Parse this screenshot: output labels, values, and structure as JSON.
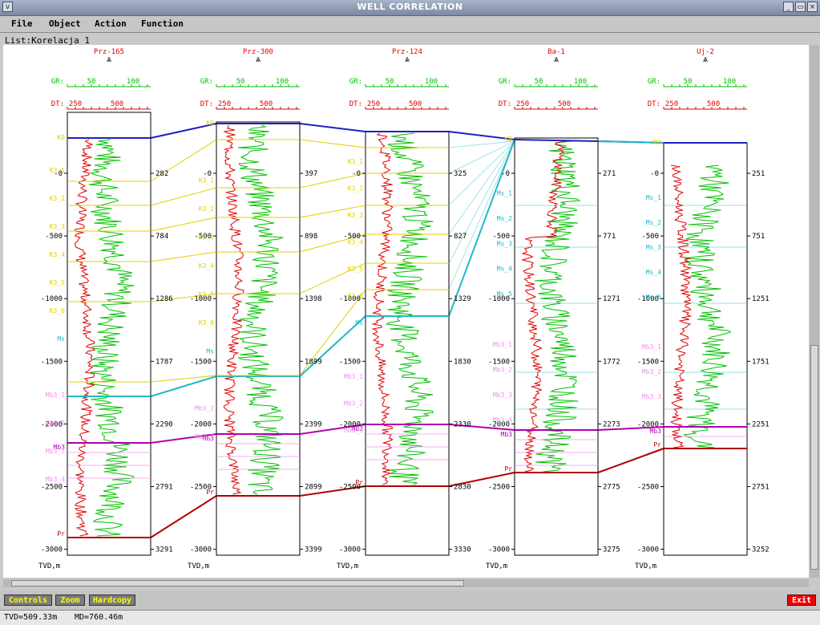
{
  "window": {
    "title": "WELL CORRELATION"
  },
  "menu": [
    "File",
    "Object",
    "Action",
    "Function"
  ],
  "list_label": "List:Korelacja_1",
  "scales": {
    "gr_label": "GR:",
    "gr_ticks": [
      "50",
      "100"
    ],
    "dt_label": "DT:",
    "dt_ticks": [
      "250",
      "500"
    ],
    "axis_unit": "TVD,m"
  },
  "depth_ticks": [
    "-0",
    "-500",
    "-1000",
    "-1500",
    "-2000",
    "-2500",
    "-3000"
  ],
  "colors": {
    "gr_curve": "#00c000",
    "dt_curve": "#e00000",
    "top_K": "#2020c0",
    "cretaceous": "#e0d000",
    "ms": "#20b8c8",
    "mb3": "#b000b0",
    "mb3_sub": "#f090f0",
    "pr": "#b00000"
  },
  "wells": [
    {
      "name": "Prz-165",
      "md_ticks": [
        "282",
        "784",
        "1286",
        "1787",
        "2290",
        "2791",
        "3291"
      ],
      "left_markers": [
        "K0",
        "K3_1",
        "K3_2",
        "K3_3",
        "K3_4",
        "K3_5",
        "K3_6",
        "Ms",
        "Mb3",
        "Mb3_1",
        "Mb3_2",
        "Mb3_3",
        "Mb3_4",
        "Pr"
      ]
    },
    {
      "name": "Prz-300",
      "md_ticks": [
        "397",
        "898",
        "1398",
        "1899",
        "2399",
        "2899",
        "3399"
      ],
      "left_markers": [
        "K0",
        "K3_1",
        "K3_2",
        "K3_3",
        "K3_4",
        "K3_5",
        "K3_6",
        "Ms",
        "Mb3",
        "Mb3_2",
        "Mb3_3",
        "Pr"
      ]
    },
    {
      "name": "Prz-124",
      "md_ticks": [
        "325",
        "827",
        "1329",
        "1830",
        "2330",
        "2830",
        "3330"
      ],
      "left_markers": [
        "K3_1",
        "K3_2",
        "K3_3",
        "K3_4",
        "K3_5",
        "K3_6",
        "Ms",
        "Mb3",
        "Mb3_1",
        "Mb3_2",
        "Mb3_3",
        "Pr"
      ]
    },
    {
      "name": "Ba-1",
      "md_ticks": [
        "271",
        "771",
        "1271",
        "1772",
        "2273",
        "2775",
        "3275"
      ],
      "left_markers": [
        "K0",
        "Ms_1",
        "Ms_2",
        "Ms_3",
        "Ms_4",
        "Ms_5",
        "Mb3",
        "Mb3_1",
        "Mb3_2",
        "Mb3_3",
        "Mb3_4",
        "Pr"
      ]
    },
    {
      "name": "Uj-2",
      "md_ticks": [
        "251",
        "751",
        "1251",
        "1751",
        "2251",
        "2751",
        "3252"
      ],
      "left_markers": [
        "K0",
        "Ms_1",
        "Ms_2",
        "Ms_3",
        "Ms_4",
        "Ms_5",
        "Mb3",
        "Mb3_1",
        "Mb3_2",
        "Mb3_3",
        "Pr"
      ]
    }
  ],
  "buttons": {
    "controls": "Controls",
    "zoom": "Zoom",
    "hardcopy": "Hardcopy",
    "exit": "Exit"
  },
  "status": {
    "tvd": "TVD=509.33m",
    "md": "MD=760.46m"
  }
}
